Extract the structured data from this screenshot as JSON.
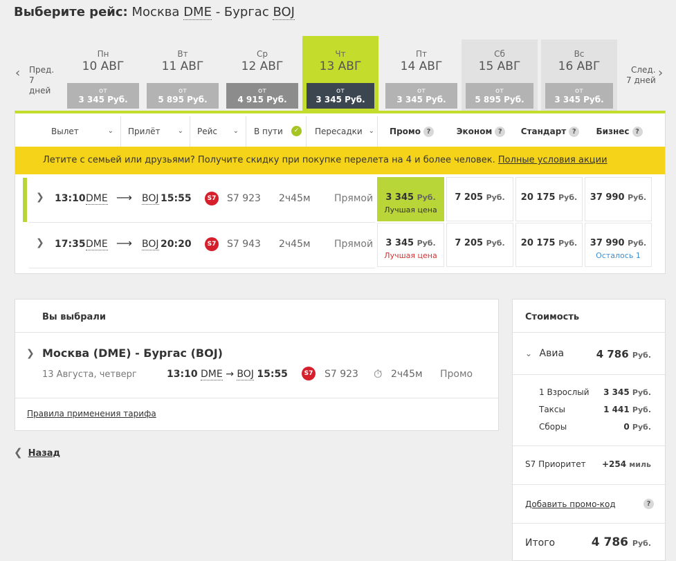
{
  "header": {
    "prefix": "Выберите рейс:",
    "from_city": "Москва",
    "from_code": "DME",
    "dash": "-",
    "to_city": "Бургас",
    "to_code": "BOJ"
  },
  "nav": {
    "prev_label": "Пред.",
    "prev_sub": "7 дней",
    "next_label": "След.",
    "next_sub": "7 дней"
  },
  "days": [
    {
      "dow": "Пн",
      "date": "10 АВГ",
      "from": "от",
      "price": "3 345 Руб."
    },
    {
      "dow": "Вт",
      "date": "11 АВГ",
      "from": "от",
      "price": "5 895 Руб."
    },
    {
      "dow": "Ср",
      "date": "12 АВГ",
      "from": "от",
      "price": "4 915 Руб."
    },
    {
      "dow": "Чт",
      "date": "13 АВГ",
      "from": "от",
      "price": "3 345 Руб."
    },
    {
      "dow": "Пт",
      "date": "14 АВГ",
      "from": "от",
      "price": "3 345 Руб."
    },
    {
      "dow": "Сб",
      "date": "15 АВГ",
      "from": "от",
      "price": "5 895 Руб."
    },
    {
      "dow": "Вс",
      "date": "16 АВГ",
      "from": "от",
      "price": "3 345 Руб."
    }
  ],
  "filters": {
    "departure": "Вылет",
    "arrival": "Прилёт",
    "flight": "Рейс",
    "duration": "В пути",
    "transfers": "Пересадки"
  },
  "fare_columns": {
    "promo": "Промо",
    "economy": "Эконом",
    "standard": "Стандарт",
    "business": "Бизнес",
    "help": "?"
  },
  "banner": {
    "text": "Летите с семьей или друзьями? Получите скидку при покупке перелета на 4 и более человек.",
    "link": "Полные условия акции"
  },
  "currency": "Руб.",
  "flights": [
    {
      "dep_time": "13:10",
      "dep_code": "DME",
      "arr_code": "BOJ",
      "arr_time": "15:55",
      "number": "S7 923",
      "duration": "2ч45м",
      "type": "Прямой",
      "promo": "3 345",
      "promo_note": "Лучшая цена",
      "economy": "7 205",
      "standard": "20 175",
      "business": "37 990",
      "business_note": ""
    },
    {
      "dep_time": "17:35",
      "dep_code": "DME",
      "arr_code": "BOJ",
      "arr_time": "20:20",
      "number": "S7 943",
      "duration": "2ч45м",
      "type": "Прямой",
      "promo": "3 345",
      "promo_note": "Лучшая цена",
      "economy": "7 205",
      "standard": "20 175",
      "business": "37 990",
      "business_note": "Осталось 1"
    }
  ],
  "airline_logo": "S7",
  "selection": {
    "heading": "Вы выбрали",
    "route": "Москва (DME) - Бургас (BOJ)",
    "date": "13 Августа, четверг",
    "dep_time": "13:10",
    "dep_code": "DME",
    "arr_code": "BOJ",
    "arr_time": "15:55",
    "number": "S7 923",
    "duration": "2ч45м",
    "fare": "Промо",
    "rules_link": "Правила применения тарифа"
  },
  "back_label": "Назад",
  "cost": {
    "title": "Стоимость",
    "avia_label": "Авиа",
    "avia_value": "4 786",
    "adult_label": "1 Взрослый",
    "adult_value": "3 345",
    "taxes_label": "Таксы",
    "taxes_value": "1 441",
    "fees_label": "Сборы",
    "fees_value": "0",
    "priority_label": "S7 Приоритет",
    "priority_value": "+254",
    "priority_unit": "миль",
    "promo_link": "Добавить промо-код",
    "total_label": "Итого",
    "total_value": "4 786"
  },
  "colors": {
    "accent": "#c4dc2b",
    "banner": "#f5d319",
    "active_price": "#3c4650",
    "logo": "#d51f2b"
  }
}
